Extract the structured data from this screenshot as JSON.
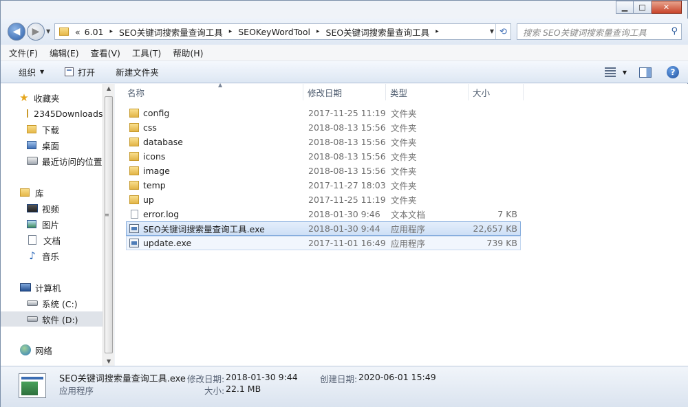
{
  "window": {
    "buttons": {
      "minimize": "▁",
      "maximize": "□",
      "close": "✕"
    }
  },
  "address": {
    "overflow": "«",
    "breadcrumbs": [
      "6.01",
      "SEO关键词搜索量查询工具",
      "SEOKeyWordTool",
      "SEO关键词搜索量查询工具"
    ],
    "separator": "▸",
    "search_placeholder": "搜索 SEO关键词搜索量查询工具"
  },
  "menu": [
    "文件(F)",
    "编辑(E)",
    "查看(V)",
    "工具(T)",
    "帮助(H)"
  ],
  "toolbar": {
    "organize": "组织",
    "open": "打开",
    "new_folder": "新建文件夹"
  },
  "nav": {
    "favorites": "收藏夹",
    "fav_items": [
      "2345Downloads",
      "下载",
      "桌面",
      "最近访问的位置"
    ],
    "libraries": "库",
    "lib_items": [
      "视频",
      "图片",
      "文档",
      "音乐"
    ],
    "computer": "计算机",
    "drives": [
      "系统 (C:)",
      "软件 (D:)"
    ],
    "network": "网络"
  },
  "columns": {
    "name": "名称",
    "date": "修改日期",
    "type": "类型",
    "size": "大小"
  },
  "files": [
    {
      "name": "config",
      "date": "2017-11-25 11:19",
      "type": "文件夹",
      "size": "",
      "icon": "folder"
    },
    {
      "name": "css",
      "date": "2018-08-13 15:56",
      "type": "文件夹",
      "size": "",
      "icon": "folder"
    },
    {
      "name": "database",
      "date": "2018-08-13 15:56",
      "type": "文件夹",
      "size": "",
      "icon": "folder"
    },
    {
      "name": "icons",
      "date": "2018-08-13 15:56",
      "type": "文件夹",
      "size": "",
      "icon": "folder"
    },
    {
      "name": "image",
      "date": "2018-08-13 15:56",
      "type": "文件夹",
      "size": "",
      "icon": "folder"
    },
    {
      "name": "temp",
      "date": "2017-11-27 18:03",
      "type": "文件夹",
      "size": "",
      "icon": "folder"
    },
    {
      "name": "up",
      "date": "2017-11-25 11:19",
      "type": "文件夹",
      "size": "",
      "icon": "folder"
    },
    {
      "name": "error.log",
      "date": "2018-01-30 9:46",
      "type": "文本文档",
      "size": "7 KB",
      "icon": "textfile"
    },
    {
      "name": "SEO关键词搜索量查询工具.exe",
      "date": "2018-01-30 9:44",
      "type": "应用程序",
      "size": "22,657 KB",
      "icon": "exe"
    },
    {
      "name": "update.exe",
      "date": "2017-11-01 16:49",
      "type": "应用程序",
      "size": "739 KB",
      "icon": "exe"
    }
  ],
  "details": {
    "filename": "SEO关键词搜索量查询工具.exe",
    "filetype": "应用程序",
    "modified_label": "修改日期:",
    "modified_value": "2018-01-30 9:44",
    "created_label": "创建日期:",
    "created_value": "2020-06-01 15:49",
    "size_label": "大小:",
    "size_value": "22.1 MB"
  }
}
